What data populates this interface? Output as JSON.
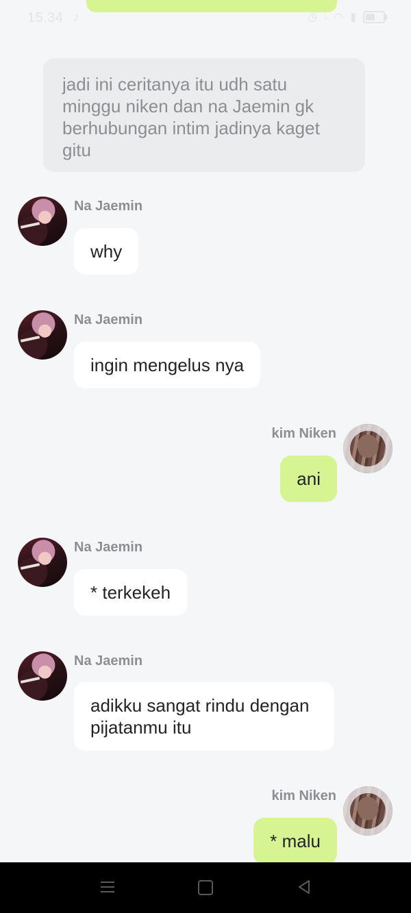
{
  "status_bar": {
    "time": "15.34",
    "note_icon": "music-note-icon",
    "battery_percent": 60
  },
  "narration": "jadi ini ceritanya itu udh satu minggu niken dan na Jaemin gk berhubungan intim jadinya kaget gitu",
  "messages": [
    {
      "sender": "Na Jaemin",
      "text": "why"
    },
    {
      "sender": "Na Jaemin",
      "text": "ingin mengelus nya"
    },
    {
      "sender": "kim Niken",
      "text": "ani"
    },
    {
      "sender": "Na Jaemin",
      "text": "* terkekeh"
    },
    {
      "sender": "Na Jaemin",
      "text": "adikku sangat rindu dengan pijatanmu itu"
    },
    {
      "sender": "kim Niken",
      "text": "* malu"
    }
  ],
  "colors": {
    "background": "#f5f6f8",
    "incoming_bubble": "#ffffff",
    "outgoing_bubble": "#d6f491",
    "narration_bubble": "#ebecee",
    "name_text": "#8b8e93"
  },
  "nav_bar": {
    "menu_icon": "menu-icon",
    "home_icon": "home-icon",
    "back_icon": "back-icon"
  }
}
